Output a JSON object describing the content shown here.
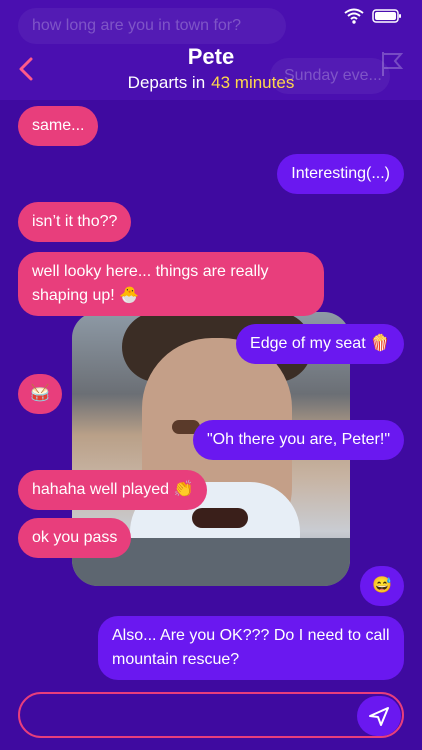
{
  "ghost": {
    "top_message": "how long are you in town for?",
    "right_message": "Sunday eve..."
  },
  "header": {
    "title": "Pete",
    "subtitle_prefix": "Departs in",
    "minutes": "43 minutes"
  },
  "messages": [
    {
      "side": "in",
      "text": "same..."
    },
    {
      "side": "out",
      "text": "Interesting(...)"
    },
    {
      "side": "in",
      "text": "isn’t it tho??"
    },
    {
      "side": "in",
      "text": "well looky here... things are really shaping up! 🐣"
    },
    {
      "side": "out",
      "text": "Edge of my seat 🍿"
    },
    {
      "side": "in",
      "text": "🥁"
    },
    {
      "side": "out",
      "text": "\"Oh there you are, Peter!\""
    },
    {
      "side": "in",
      "text": "hahaha well played 👏"
    },
    {
      "side": "in",
      "text": "ok you pass"
    },
    {
      "side": "out",
      "text": "😅"
    },
    {
      "side": "out",
      "text": "Also... Are you OK??? Do I need to call mountain rescue?"
    }
  ],
  "composer": {
    "value": "",
    "placeholder": ""
  },
  "colors": {
    "background": "#3f0aa0",
    "incoming": "#e83e7c",
    "outgoing": "#6a18f0",
    "highlight": "#ffd84a"
  }
}
